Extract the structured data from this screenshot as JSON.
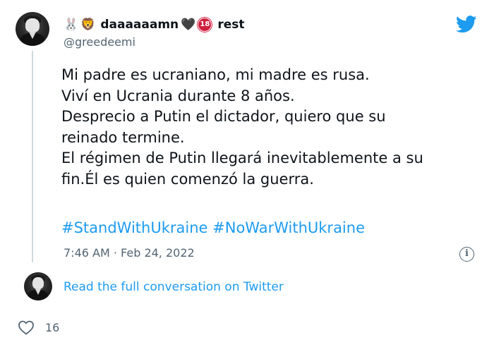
{
  "tweet": {
    "author": {
      "emojis": [
        "🐰",
        "🦁"
      ],
      "display_name": "daaaaaamn",
      "heart": "🖤",
      "badge": "18",
      "name_suffix": "rest",
      "handle": "@greedeemi"
    },
    "text_lines": [
      "Mi padre es ucraniano, mi madre es rusa.",
      "Viví en Ucrania durante 8 años.",
      "Desprecio a Putin el dictador, quiero que su",
      "reinado termine.",
      "El régimen de Putin llegará inevitablemente a su",
      "fin.Él es quien comenzó la guerra."
    ],
    "hashtags": [
      "#StandWithUkraine",
      "#NoWarWithUkraine"
    ],
    "timestamp": "7:46 AM · Feb 24, 2022",
    "info_symbol": "i",
    "read_more": "Read the full conversation on Twitter",
    "likes": "16"
  },
  "icons": {
    "brand": "twitter-bird-icon",
    "info": "info-icon",
    "like": "heart-outline-icon"
  },
  "colors": {
    "link": "#1d9bf0",
    "text": "#0f1419",
    "muted": "#536471",
    "thread_line": "#cfd9de",
    "badge": "#d02040"
  }
}
